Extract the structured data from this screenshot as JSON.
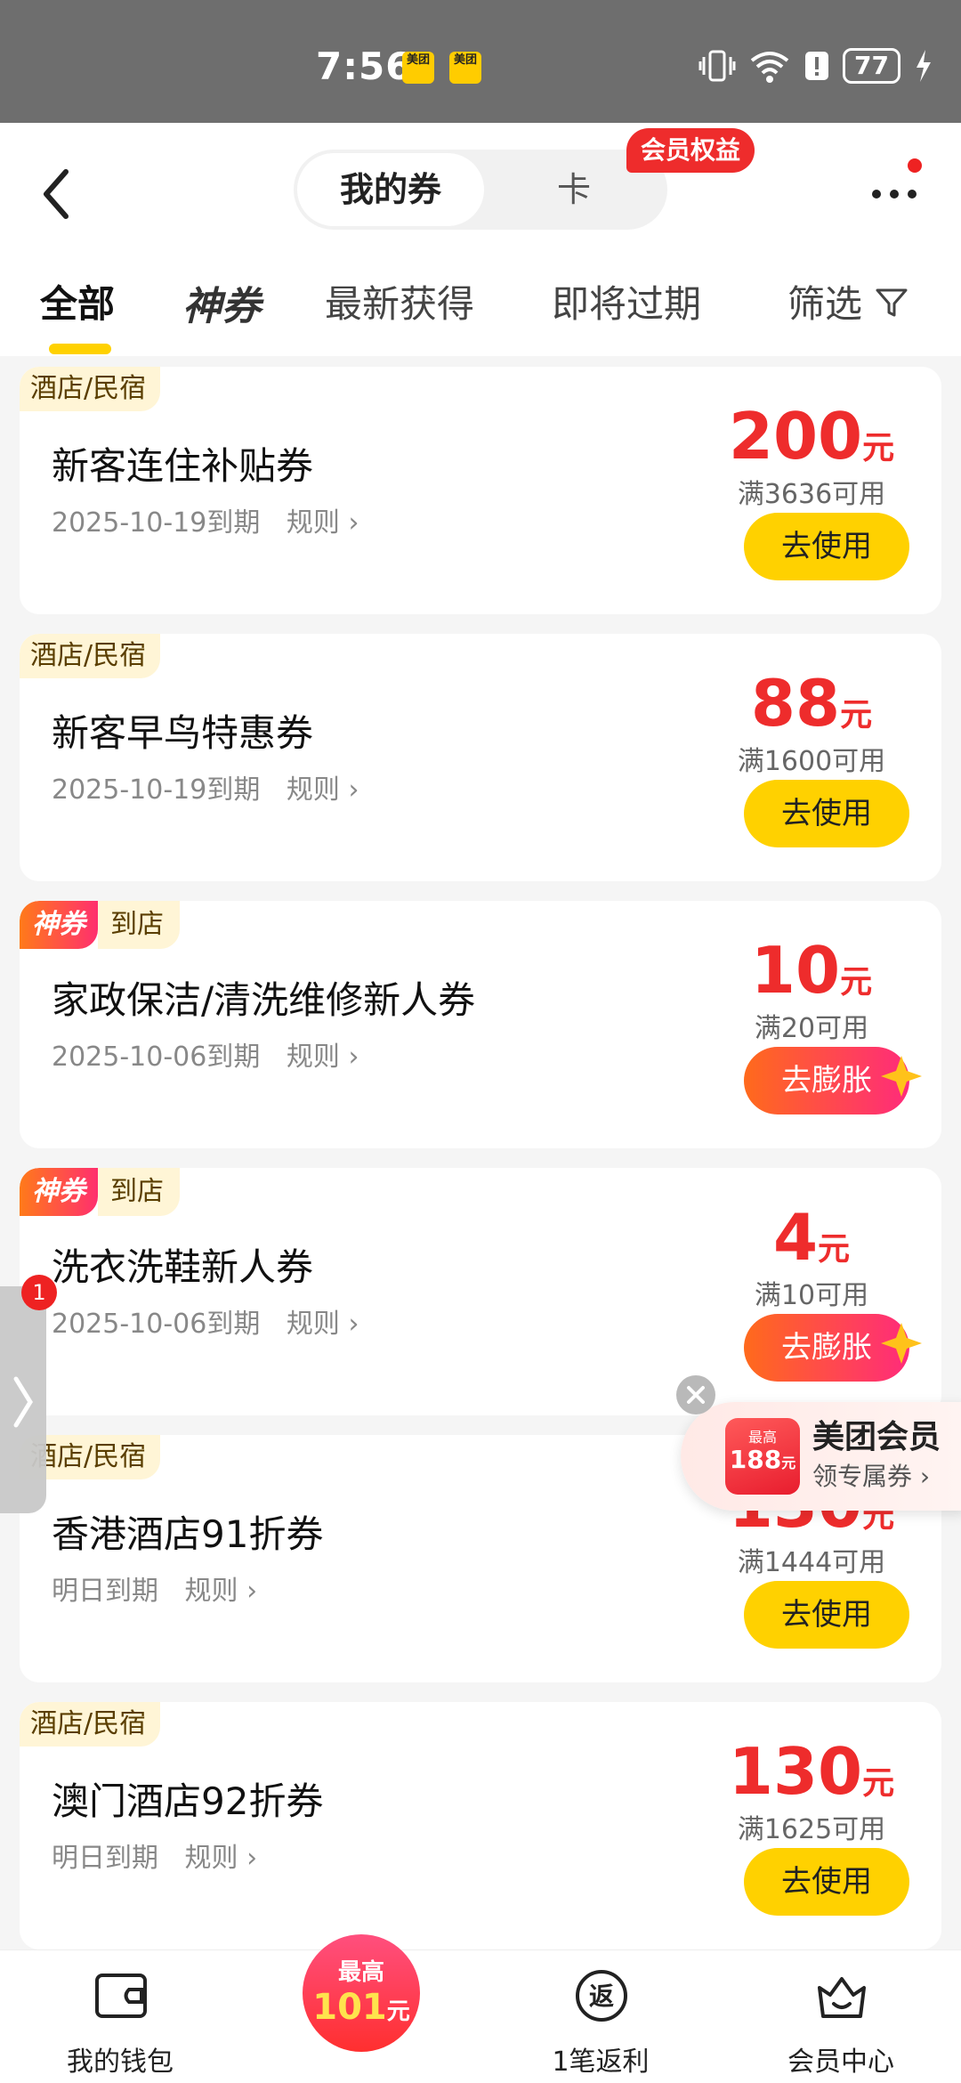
{
  "status_bar": {
    "time": "7:56",
    "app_icon_1": "美团",
    "app_icon_2": "美团",
    "battery": "77"
  },
  "header": {
    "segment_active": "我的券",
    "segment_other": "卡",
    "member_badge": "会员权益",
    "more_icon": "more-dots-icon"
  },
  "tabs": {
    "all": "全部",
    "shenquan": "神券",
    "newest": "最新获得",
    "expiring": "即将过期",
    "filter": "筛选"
  },
  "coupons": [
    {
      "tag": "酒店/民宿",
      "title": "新客连住补贴券",
      "expiry": "2025-10-19到期",
      "rule": "规则",
      "amount": "200",
      "unit": "元",
      "condition": "满3636可用",
      "button": "去使用"
    },
    {
      "tag": "酒店/民宿",
      "title": "新客早鸟特惠券",
      "expiry": "2025-10-19到期",
      "rule": "规则",
      "amount": "88",
      "unit": "元",
      "condition": "满1600可用",
      "button": "去使用"
    },
    {
      "tag_shen": "神券",
      "tag": "到店",
      "title": "家政保洁/清洗维修新人券",
      "expiry": "2025-10-06到期",
      "rule": "规则",
      "amount": "10",
      "unit": "元",
      "condition": "满20可用",
      "button": "去膨胀"
    },
    {
      "tag_shen": "神券",
      "tag": "到店",
      "title": "洗衣洗鞋新人券",
      "expiry": "2025-10-06到期",
      "rule": "规则",
      "amount": "4",
      "unit": "元",
      "condition": "满10可用",
      "button": "去膨胀"
    },
    {
      "tag": "酒店/民宿",
      "title": "香港酒店91折券",
      "expiry": "明日到期",
      "rule": "规则",
      "amount": "130",
      "unit": "元",
      "condition": "满1444可用",
      "button": "去使用"
    },
    {
      "tag": "酒店/民宿",
      "title": "澳门酒店92折券",
      "expiry": "明日到期",
      "rule": "规则",
      "amount": "130",
      "unit": "元",
      "condition": "满1625可用",
      "button": "去使用"
    }
  ],
  "side_tab": {
    "badge": "1"
  },
  "promo": {
    "pic_top": "最高",
    "pic_amount": "188",
    "pic_unit": "元",
    "title": "美团会员",
    "subtitle": "领专属券"
  },
  "bottom_nav": {
    "wallet": "我的钱包",
    "center_top": "最高",
    "center_amount": "101",
    "center_unit": "元",
    "rebate": "1笔返利",
    "rebate_icon_text": "返",
    "member_center": "会员中心"
  },
  "colors": {
    "accent_yellow": "#ffd100",
    "price_red": "#ee2c2c",
    "pump_gradient_start": "#ff6a1c",
    "pump_gradient_end": "#ff2b7b"
  }
}
